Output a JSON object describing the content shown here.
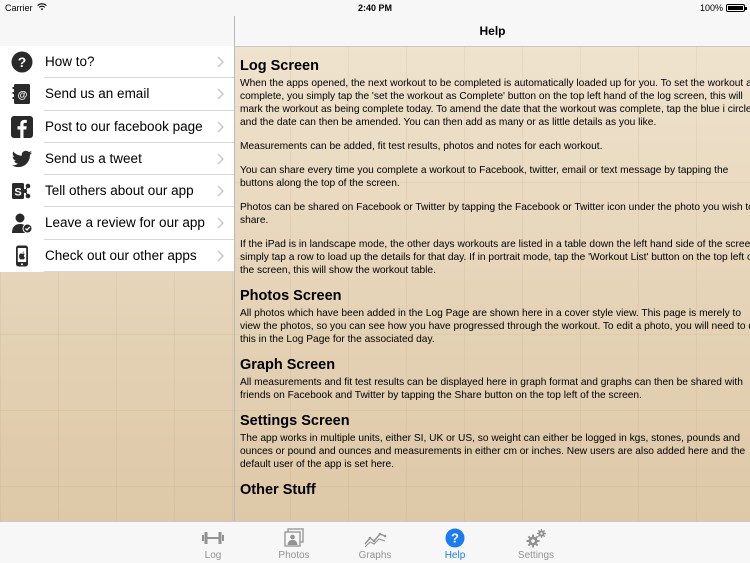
{
  "status_bar": {
    "carrier": "Carrier",
    "time": "2:40 PM",
    "battery": "100%"
  },
  "nav": {
    "title": "Help"
  },
  "menu": {
    "items": [
      {
        "label": "How to?",
        "icon": "question-icon"
      },
      {
        "label": "Send us an email",
        "icon": "email-icon"
      },
      {
        "label": "Post to our facebook page",
        "icon": "facebook-icon"
      },
      {
        "label": "Send us a tweet",
        "icon": "twitter-icon"
      },
      {
        "label": "Tell others about our app",
        "icon": "share-icon"
      },
      {
        "label": "Leave a review for our app",
        "icon": "review-icon"
      },
      {
        "label": "Check out our other apps",
        "icon": "apps-icon"
      }
    ]
  },
  "content": {
    "sections": [
      {
        "title": "Log Screen",
        "paragraphs": [
          "When the apps opened, the next workout to be completed is automatically loaded up for you. To set the workout as complete, you simply tap the 'set the workout as Complete' button on the top left hand of the log screen, this will mark the workout as being complete today.  To amend the date that the workout was complete, tap the blue i circle and the date can then be amended. You can then add as many or as little details as you like.",
          "Measurements can be added, fit test results, photos and notes for each workout.",
          "You can share every time you complete a workout to Facebook, twitter, email or text message by tapping the buttons along the top of the screen.",
          "Photos can be shared on Facebook or Twitter by tapping the Facebook or Twitter icon under the photo you wish to share.",
          "If the iPad is in landscape mode, the other days workouts are listed in a table down the left hand side of the screen, simply tap a row to load up the details for that day. If in portrait mode, tap the 'Workout List' button on the top left of the screen, this will show the workout table."
        ]
      },
      {
        "title": "Photos Screen",
        "paragraphs": [
          "All photos which have been added in the Log Page are shown here in a cover style view.  This page is merely to view the photos, so you can see how you have progressed through the workout.  To edit a photo, you will need to do this in the Log Page for the associated day."
        ]
      },
      {
        "title": "Graph Screen",
        "paragraphs": [
          "All measurements and fit test results can be displayed here in graph format and graphs can then be shared with friends on Facebook and Twitter by tapping the Share button on the top left of the screen."
        ]
      },
      {
        "title": "Settings Screen",
        "paragraphs": [
          "The app works in multiple units, either SI, UK or US, so weight can either be logged in kgs, stones, pounds and ounces or pound and ounces and measurements in either cm or inches.  New users are also added here and the default user of the app is set here."
        ]
      },
      {
        "title": "Other Stuff",
        "paragraphs": []
      }
    ]
  },
  "tab_bar": {
    "tabs": [
      {
        "label": "Log",
        "icon": "dumbbell-icon",
        "active": false
      },
      {
        "label": "Photos",
        "icon": "photos-icon",
        "active": false
      },
      {
        "label": "Graphs",
        "icon": "graph-icon",
        "active": false
      },
      {
        "label": "Help",
        "icon": "help-icon",
        "active": true
      },
      {
        "label": "Settings",
        "icon": "gears-icon",
        "active": false
      }
    ]
  },
  "colors": {
    "accent": "#1a7cf5",
    "inactive_tab": "#929292",
    "facebook": "#3b5998",
    "twitter": "#2a2a2a"
  }
}
